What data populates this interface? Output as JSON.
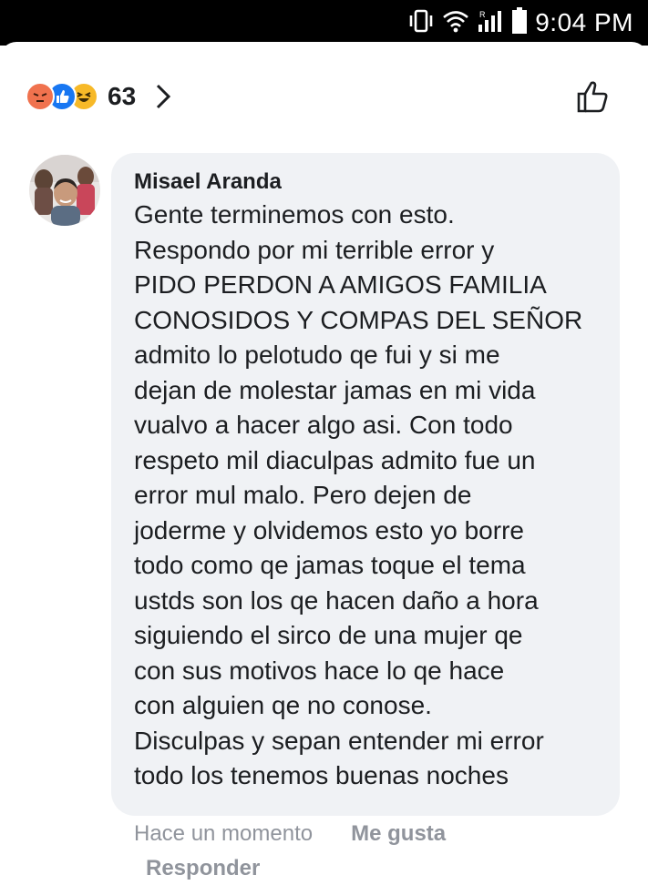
{
  "status_bar": {
    "time": "9:04 PM",
    "icons": [
      "vibrate-icon",
      "wifi-icon",
      "signal-icon",
      "battery-icon"
    ],
    "background": "#000000"
  },
  "reactions": {
    "types": [
      "angry",
      "like",
      "haha"
    ],
    "count": "63",
    "colors": {
      "angry": "#f0724e",
      "like": "#1877f2",
      "haha": "#f7b928"
    }
  },
  "comment": {
    "author": "Misael Aranda",
    "lines": [
      "Gente terminemos con esto.",
      "Respondo por mi terrible error y",
      "PIDO PERDON A AMIGOS FAMILIA",
      "CONOSIDOS Y COMPAS DEL SEÑOR",
      "admito lo pelotudo qe fui y si me",
      "dejan de molestar jamas en mi vida",
      "vualvo a hacer algo asi. Con todo",
      "respeto mil diaculpas admito fue un",
      "error mul malo. Pero dejen de",
      "joderme y olvidemos esto yo borre",
      "todo como qe jamas toque el tema",
      "ustds son los qe hacen daño a hora",
      "siguiendo el sirco de una mujer qe",
      "con sus motivos hace lo qe hace",
      "con alguien qe no conose.",
      "Disculpas y sepan entender mi error",
      "todo los tenemos buenas noches"
    ],
    "timestamp": "Hace un momento",
    "like_label": "Me gusta",
    "reply_label": "Responder",
    "bubble_color": "#f0f2f5"
  }
}
